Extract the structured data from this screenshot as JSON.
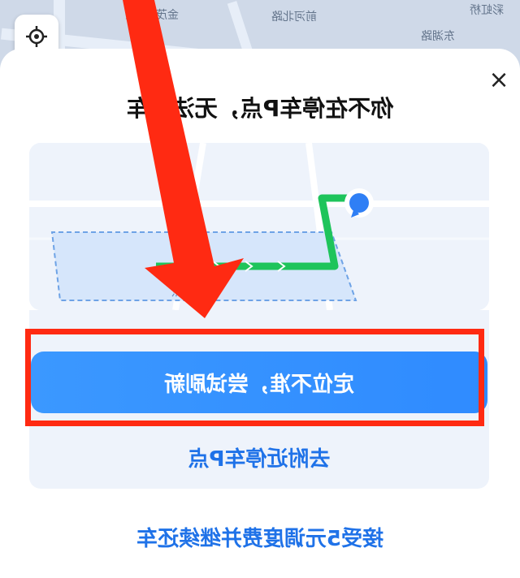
{
  "map": {
    "labels": [
      "东湖路",
      "前河北路",
      "金茂湾C区",
      "彩虹桥"
    ]
  },
  "dialog": {
    "title": "你不在停车P点，无法还车",
    "close_symbol": "×",
    "parking_zone_label": "停车P点",
    "primary_button": "定位不准，尝试刷新",
    "go_nearby_link": "去附近停车P点",
    "accept_fee_link": "接受5元调度费并继续还车"
  },
  "colors": {
    "accent": "#2f8bff",
    "route": "#1ec45b",
    "annotation": "#ff2a12"
  },
  "icons": [
    "close-icon",
    "locate-icon",
    "user-location-icon",
    "arrow-annotation-icon"
  ]
}
